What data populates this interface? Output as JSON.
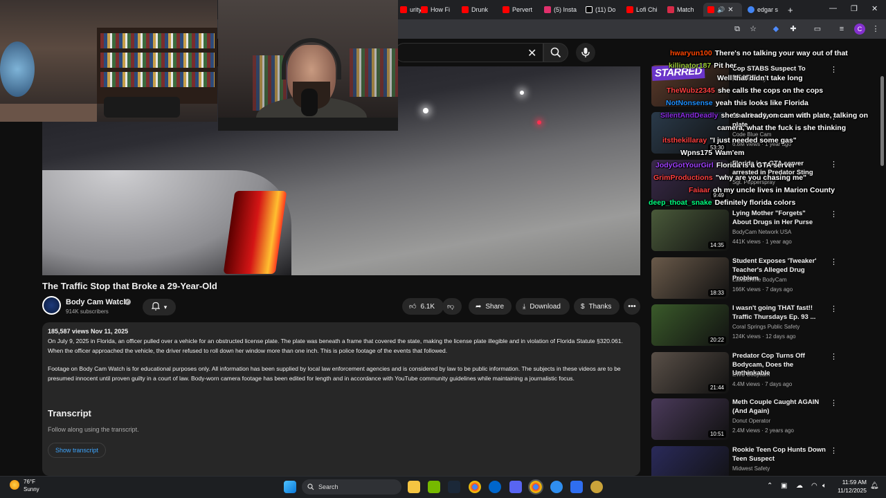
{
  "browser": {
    "tabs": [
      {
        "label": "urity",
        "color": "#ff0000"
      },
      {
        "label": "How Fi",
        "color": "#ff0000"
      },
      {
        "label": "Drunk",
        "color": "#ff0000"
      },
      {
        "label": "Pervert",
        "color": "#ff0000"
      },
      {
        "label": "(5) Insta",
        "color": "#e1306c"
      },
      {
        "label": "(11) Do",
        "color": "#ffffff"
      },
      {
        "label": "Lofi Chi",
        "color": "#ff0000"
      },
      {
        "label": "Match",
        "color": "#d62b48"
      },
      {
        "label": "",
        "color": "#ff0000"
      },
      {
        "label": "edgar s",
        "color": "#4285f4"
      }
    ],
    "new_tab": "+",
    "profile_initial": "C"
  },
  "youtube": {
    "video": {
      "title": "The Traffic Stop that Broke a 29-Year-Old"
    },
    "channel": {
      "name": "Body Cam Watch",
      "subscribers": "914K subscribers"
    },
    "actions": {
      "likes": "6.1K",
      "share": "Share",
      "download": "Download",
      "thanks": "Thanks"
    },
    "description": {
      "stats": "185,587 views  Nov 11, 2025",
      "paragraph1": "On July 9, 2025 in Florida, an officer pulled over a vehicle for an obstructed license plate. The plate was beneath a frame that covered the state, making the license plate illegible and in violation of Florida Statute §320.061. When the officer approached the vehicle, the driver refused to roll down her window more than one inch. This is police footage of the events that followed.",
      "paragraph2": "Footage on Body Cam Watch is for educational purposes only. All information has been supplied by local law enforcement agencies and is considered by law to be public information. The subjects in these videos are to be presumed innocent until proven guilty in a court of law. Body-worn camera footage has been edited for length and in accordance with YouTube community guidelines while maintaining a journalistic focus."
    },
    "transcript": {
      "heading": "Transcript",
      "subtitle": "Follow along using the transcript.",
      "button": "Show transcript"
    },
    "recommendations": [
      {
        "title": "Cop STABS Suspect To DEATH!",
        "channel": "Police Activity",
        "meta": "",
        "duration": "",
        "thumb": "#5b3a2a"
      },
      {
        "title": "She already on cam with plate",
        "channel": "Code Blue Cam",
        "meta": "6.8M views · 1 year ago",
        "duration": "53:30",
        "thumb": "#2a3a4a"
      },
      {
        "title": "Florida is a GTA server arrested in Predator Sting",
        "channel": "Sgt. Pepperspray",
        "meta": "",
        "duration": "9:49",
        "thumb": "#3a2a4a"
      },
      {
        "title": "Lying Mother \"Forgets\" About Drugs in Her Purse",
        "channel": "BodyCam Network USA",
        "meta": "441K views · 1 year ago",
        "duration": "14:35",
        "thumb": "#4a5a3a"
      },
      {
        "title": "Student Exposes 'Tweaker' Teacher's Alleged Drug Problem",
        "channel": "Law&Crime BodyCam",
        "meta": "166K views · 7 days ago",
        "duration": "18:33",
        "thumb": "#6a5a4a"
      },
      {
        "title": "I wasn't going THAT fast!! Traffic Thursdays Ep. 93 ...",
        "channel": "Coral Springs Public Safety",
        "meta": "124K views · 12 days ago",
        "duration": "20:22",
        "thumb": "#3a5a2a"
      },
      {
        "title": "Predator Cop Turns Off Bodycam, Does the Unthinkable",
        "channel": "EWU Bodycam",
        "meta": "4.4M views · 7 days ago",
        "duration": "21:44",
        "thumb": "#5a5048"
      },
      {
        "title": "Meth Couple Caught AGAIN (And Again)",
        "channel": "Donut Operator",
        "meta": "2.4M views · 2 years ago",
        "duration": "10:51",
        "thumb": "#4a3a5a"
      },
      {
        "title": "Rookie Teen Cop Hunts Down Teen Suspect",
        "channel": "Midwest Safety",
        "meta": "",
        "duration": "",
        "thumb": "#2a2a5a"
      }
    ]
  },
  "chat": [
    {
      "user": "hwaryun100",
      "color": "#ff4500",
      "msg": "There's no talking your way out of that"
    },
    {
      "user": "killinator187",
      "color": "#9acd32",
      "msg": "Pit her"
    },
    {
      "user": "",
      "color": "#ffffff",
      "msg": "Well that didn't take long"
    },
    {
      "user": "TheWubz2345",
      "color": "#ff4040",
      "msg": "she calls the cops on the cops"
    },
    {
      "user": "NotNonsense",
      "color": "#1e90ff",
      "msg": "yeah this looks like Florida"
    },
    {
      "user": "SilentAndDeadly",
      "color": "#8a2be2",
      "msg": "she's already on cam with plate, talking on"
    },
    {
      "user": "",
      "color": "#ffffff",
      "msg": "camera, what the fuck is she thinking"
    },
    {
      "user": "itsthekillaray",
      "color": "#ff4040",
      "msg": "\"I just needed some gas\""
    },
    {
      "user": "Wpns175",
      "color": "#ffffff",
      "msg": "Wam'em"
    },
    {
      "user": "JodyGotYourGirl",
      "color": "#a040ff",
      "msg": "Florida is a GTA server"
    },
    {
      "user": "GrimProductions",
      "color": "#ff4040",
      "msg": "\"why are you chasing me\""
    },
    {
      "user": "Faiaar",
      "color": "#ff4040",
      "msg": "oh my uncle lives in Marion County"
    },
    {
      "user": "deep_thoat_snake",
      "color": "#00ff7f",
      "msg": "Definitely florida colors"
    }
  ],
  "chat_badge": "STARRED",
  "taskbar": {
    "temperature": "76°F",
    "condition": "Sunny",
    "search": "Search",
    "time": "11:59 AM",
    "date": "11/12/2025"
  }
}
